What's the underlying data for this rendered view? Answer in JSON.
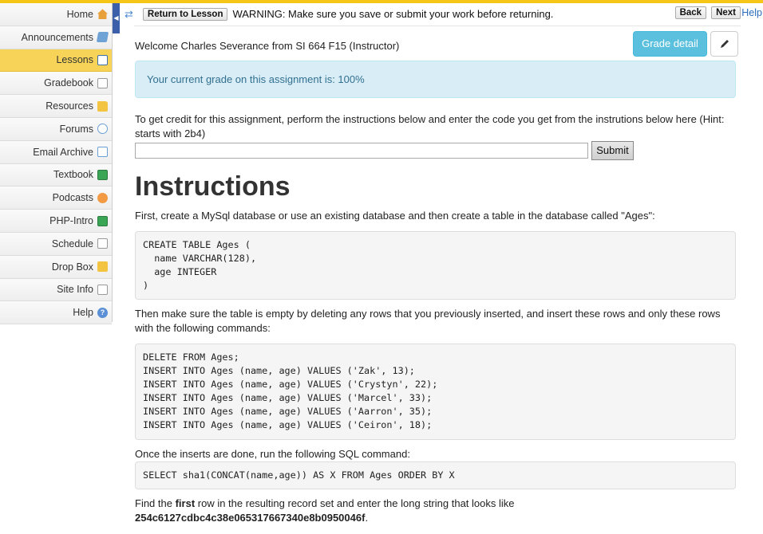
{
  "sidebar": {
    "items": [
      {
        "label": "Home",
        "icon": "home-icon"
      },
      {
        "label": "Announcements",
        "icon": "announcements-icon"
      },
      {
        "label": "Lessons",
        "icon": "book-icon",
        "active": true
      },
      {
        "label": "Gradebook",
        "icon": "gradebook-icon"
      },
      {
        "label": "Resources",
        "icon": "folder-icon"
      },
      {
        "label": "Forums",
        "icon": "speech-bubble-icon"
      },
      {
        "label": "Email Archive",
        "icon": "envelope-icon"
      },
      {
        "label": "Textbook",
        "icon": "textbook-icon"
      },
      {
        "label": "Podcasts",
        "icon": "podcast-icon"
      },
      {
        "label": "PHP-Intro",
        "icon": "php-intro-icon"
      },
      {
        "label": "Schedule",
        "icon": "calendar-icon"
      },
      {
        "label": "Drop Box",
        "icon": "dropbox-icon"
      },
      {
        "label": "Site Info",
        "icon": "site-info-icon"
      },
      {
        "label": "Help",
        "icon": "help-icon"
      }
    ]
  },
  "toolbar": {
    "return_label": "Return to Lesson",
    "warning": "WARNING: Make sure you save or submit your work before returning.",
    "back_label": "Back",
    "next_label": "Next",
    "help_label": "Help"
  },
  "main": {
    "welcome": "Welcome Charles Severance from SI 664 F15 (Instructor)",
    "grade_detail_label": "Grade detail",
    "grade_alert": "Your current grade on this assignment is: 100%",
    "credit_text": "To get credit for this assignment, perform the instructions below and enter the code you get from the instrutions below here (Hint: starts with 2b4)",
    "code_value": "",
    "submit_label": "Submit",
    "instructions_title": "Instructions",
    "para1": "First, create a MySql database or use an existing database and then create a table in the database called \"Ages\":",
    "code1": "CREATE TABLE Ages (\n  name VARCHAR(128),\n  age INTEGER\n)",
    "para2": "Then make sure the table is empty by deleting any rows that you previously inserted, and insert these rows and only these rows with the following commands:",
    "code2": "DELETE FROM Ages;\nINSERT INTO Ages (name, age) VALUES ('Zak', 13);\nINSERT INTO Ages (name, age) VALUES ('Crystyn', 22);\nINSERT INTO Ages (name, age) VALUES ('Marcel', 33);\nINSERT INTO Ages (name, age) VALUES ('Aarron', 35);\nINSERT INTO Ages (name, age) VALUES ('Ceiron', 18);",
    "para3": "Once the inserts are done, run the following SQL command:",
    "code3": "SELECT sha1(CONCAT(name,age)) AS X FROM Ages ORDER BY X",
    "para4_a": "Find the ",
    "para4_b": "first",
    "para4_c": " row in the resulting record set and enter the long string that looks like",
    "para4_hash": "254c6127cdbc4c38e065317667340e8b0950046f",
    "para4_end": "."
  },
  "colors": {
    "accent_yellow": "#f5c518",
    "grade_button": "#5bc0de",
    "alert_bg": "#d9edf7",
    "alert_text": "#31708f"
  }
}
